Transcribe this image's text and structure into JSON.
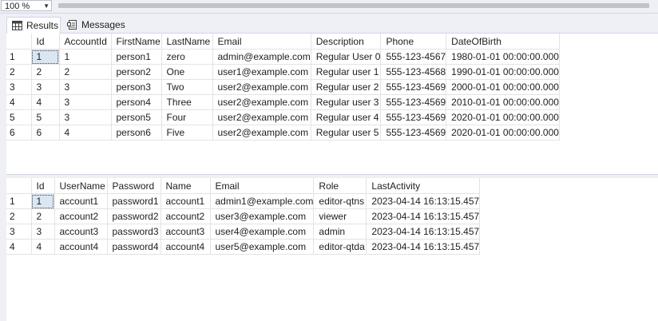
{
  "toolbar": {
    "zoom": "100 %"
  },
  "tabs": [
    {
      "label": "Results",
      "icon": "grid-icon"
    },
    {
      "label": "Messages",
      "icon": "messages-icon"
    }
  ],
  "grid1": {
    "columns": [
      "Id",
      "AccountId",
      "FirstName",
      "LastName",
      "Email",
      "Description",
      "Phone",
      "DateOfBirth"
    ],
    "rows": [
      {
        "n": "1",
        "cells": [
          "1",
          "1",
          "person1",
          "zero",
          "admin@example.com",
          "Regular User 0",
          "555-123-4567",
          "1980-01-01 00:00:00.000"
        ]
      },
      {
        "n": "2",
        "cells": [
          "2",
          "2",
          "person2",
          "One",
          "user1@example.com",
          "Regular user 1",
          "555-123-4568",
          "1990-01-01 00:00:00.000"
        ]
      },
      {
        "n": "3",
        "cells": [
          "3",
          "3",
          "person3",
          "Two",
          "user2@example.com",
          "Regular user 2",
          "555-123-4569",
          "2000-01-01 00:00:00.000"
        ]
      },
      {
        "n": "4",
        "cells": [
          "4",
          "3",
          "person4",
          "Three",
          "user2@example.com",
          "Regular user 3",
          "555-123-4569",
          "2010-01-01 00:00:00.000"
        ]
      },
      {
        "n": "5",
        "cells": [
          "5",
          "3",
          "person5",
          "Four",
          "user2@example.com",
          "Regular user 4",
          "555-123-4569",
          "2020-01-01 00:00:00.000"
        ]
      },
      {
        "n": "6",
        "cells": [
          "6",
          "4",
          "person6",
          "Five",
          "user2@example.com",
          "Regular user 5",
          "555-123-4569",
          "2020-01-01 00:00:00.000"
        ]
      }
    ]
  },
  "grid2": {
    "columns": [
      "Id",
      "UserName",
      "Password",
      "Name",
      "Email",
      "Role",
      "LastActivity"
    ],
    "rows": [
      {
        "n": "1",
        "cells": [
          "1",
          "account1",
          "password1",
          "account1",
          "admin1@example.com",
          "editor-qtns",
          "2023-04-14 16:13:15.457"
        ]
      },
      {
        "n": "2",
        "cells": [
          "2",
          "account2",
          "password2",
          "account2",
          "user3@example.com",
          "viewer",
          "2023-04-14 16:13:15.457"
        ]
      },
      {
        "n": "3",
        "cells": [
          "3",
          "account3",
          "password3",
          "account3",
          "user4@example.com",
          "admin",
          "2023-04-14 16:13:15.457"
        ]
      },
      {
        "n": "4",
        "cells": [
          "4",
          "account4",
          "password4",
          "account4",
          "user5@example.com",
          "editor-qtda",
          "2023-04-14 16:13:15.457"
        ]
      }
    ]
  }
}
